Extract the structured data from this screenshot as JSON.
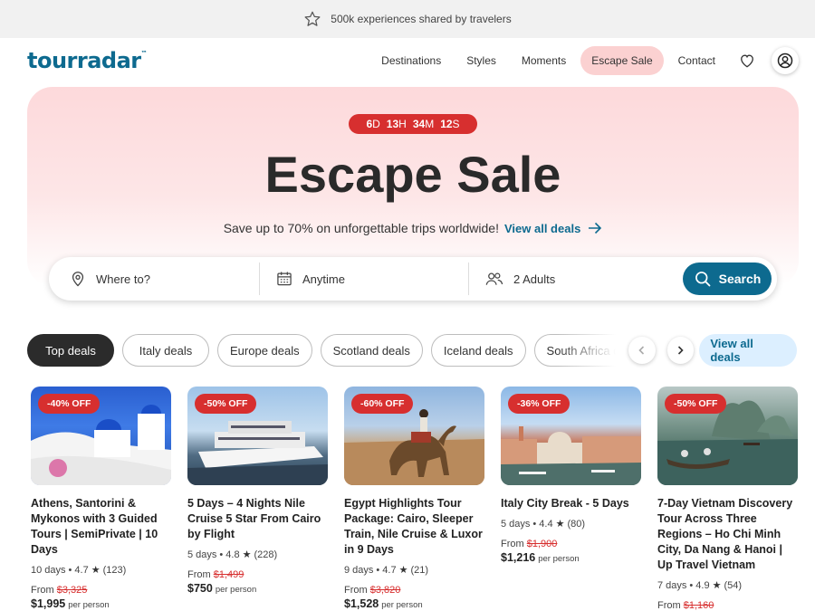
{
  "topbar": {
    "text": "500k experiences shared by travelers"
  },
  "nav": {
    "logo": "tourradar",
    "logo_tm": "™",
    "links": [
      "Destinations",
      "Styles",
      "Moments",
      "Escape Sale",
      "Contact"
    ]
  },
  "hero": {
    "countdown": {
      "days": "6",
      "days_unit": "D",
      "hours": "13",
      "hours_unit": "H",
      "minutes": "34",
      "minutes_unit": "M",
      "seconds": "12",
      "seconds_unit": "S"
    },
    "title": "Escape Sale",
    "subtitle": "Save up to 70% on unforgettable trips worldwide!",
    "link": "View all deals"
  },
  "search": {
    "where": "Where to?",
    "when": "Anytime",
    "who": "2 Adults",
    "button": "Search"
  },
  "chips": [
    "Top deals",
    "Italy deals",
    "Europe deals",
    "Scotland deals",
    "Iceland deals",
    "South Africa deals"
  ],
  "chips_view_all": "View all deals",
  "cards": [
    {
      "badge": "-40% OFF",
      "title": "Athens, Santorini & Mykonos with 3 Guided Tours | SemiPrivate | 10 Days",
      "duration": "10 days",
      "rating": "4.7",
      "reviews": "(123)",
      "from_label": "From",
      "old_price": "$3,325",
      "price": "$1,995",
      "per": "per person"
    },
    {
      "badge": "-50% OFF",
      "title": "5 Days – 4 Nights Nile Cruise 5 Star From Cairo by Flight",
      "duration": "5 days",
      "rating": "4.8",
      "reviews": "(228)",
      "from_label": "From",
      "old_price": "$1,499",
      "price": "$750",
      "per": "per person"
    },
    {
      "badge": "-60% OFF",
      "title": "Egypt Highlights Tour Package: Cairo, Sleeper Train, Nile Cruise & Luxor in 9 Days",
      "duration": "9 days",
      "rating": "4.7",
      "reviews": "(21)",
      "from_label": "From",
      "old_price": "$3,820",
      "price": "$1,528",
      "per": "per person"
    },
    {
      "badge": "-36% OFF",
      "title": "Italy City Break - 5 Days",
      "duration": "5 days",
      "rating": "4.4",
      "reviews": "(80)",
      "from_label": "From",
      "old_price": "$1,900",
      "price": "$1,216",
      "per": "per person"
    },
    {
      "badge": "-50% OFF",
      "title": "7-Day Vietnam Discovery Tour Across Three Regions – Ho Chi Minh City, Da Nang & Hanoi | Up Travel Vietnam",
      "duration": "7 days",
      "rating": "4.9",
      "reviews": "(54)",
      "from_label": "From",
      "old_price": "$1,160",
      "price": "",
      "per": ""
    }
  ],
  "colors": {
    "brand": "#0d6a8f",
    "sale_red": "#d72f2f",
    "hero_pink": "#fdd9db"
  }
}
